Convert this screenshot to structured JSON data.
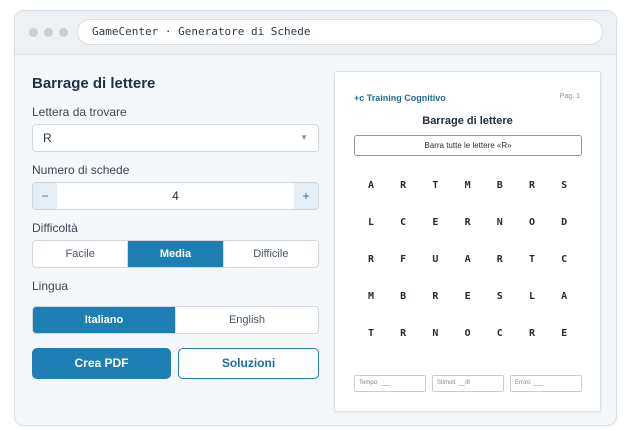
{
  "window": {
    "address": "GameCenter · Generatore di Schede"
  },
  "form": {
    "title": "Barrage di lettere",
    "letter_label": "Lettera da trovare",
    "letter_value": "R",
    "count_label": "Numero di schede",
    "count_value": "4",
    "minus": "−",
    "plus": "+",
    "difficulty_label": "Difficoltà",
    "difficulty_options": [
      "Facile",
      "Media",
      "Difficile"
    ],
    "difficulty_selected": "Media",
    "language_label": "Lingua",
    "language_options": [
      "Italiano",
      "English"
    ],
    "language_selected": "Italiano",
    "create_pdf": "Crea PDF",
    "solutions": "Soluzioni"
  },
  "preview": {
    "brand": "+c Training Cognitivo",
    "page": "Pag. 1",
    "title": "Barrage di lettere",
    "instruction": "Barra tutte le lettere «R»",
    "grid": [
      [
        "A",
        "R",
        "T",
        "M",
        "B",
        "R",
        "S"
      ],
      [
        "L",
        "C",
        "E",
        "R",
        "N",
        "O",
        "D"
      ],
      [
        "R",
        "F",
        "U",
        "A",
        "R",
        "T",
        "C"
      ],
      [
        "M",
        "B",
        "R",
        "E",
        "S",
        "L",
        "A"
      ],
      [
        "T",
        "R",
        "N",
        "O",
        "C",
        "R",
        "E"
      ]
    ],
    "fields": [
      "Tempo: ___",
      "Stimoli: __/8",
      "Errori: ___"
    ]
  },
  "colors": {
    "accent": "#1d7fb3",
    "background": "#f5f8fb"
  }
}
